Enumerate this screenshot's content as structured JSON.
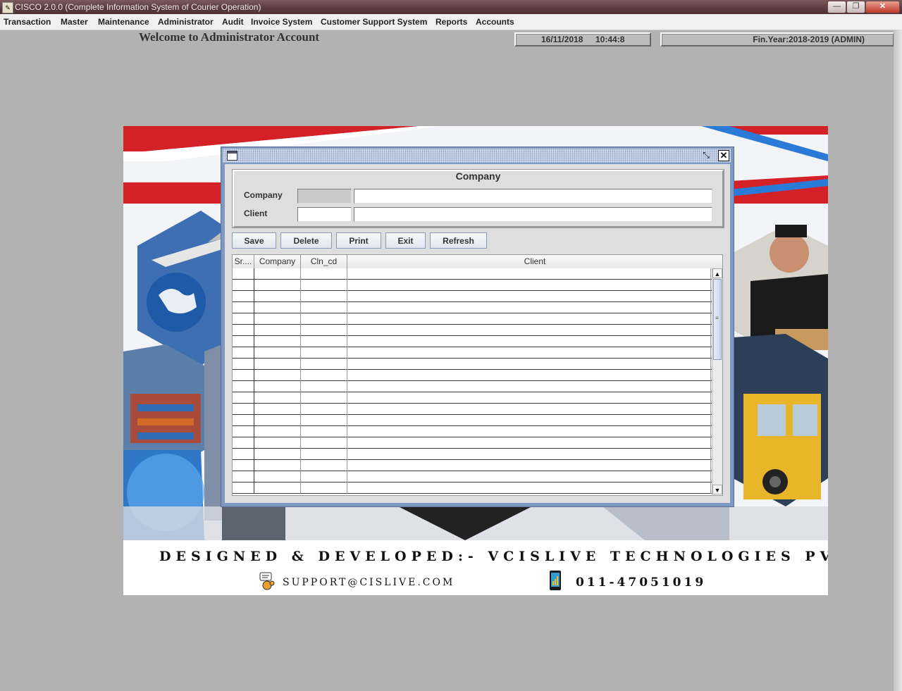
{
  "window": {
    "title": "CISCO 2.0.0 (Complete Information System of Courier Operation)",
    "app_icon": "app-icon",
    "controls": {
      "minimize": "—",
      "maximize": "❐",
      "close": "✕"
    }
  },
  "menu": {
    "items": [
      {
        "label": "Transaction"
      },
      {
        "label": "Master"
      },
      {
        "label": "Maintenance"
      },
      {
        "label": "Administrator"
      },
      {
        "label": "Audit"
      },
      {
        "label": "Invoice System"
      },
      {
        "label": "Customer Support System"
      },
      {
        "label": "Reports"
      },
      {
        "label": "Accounts"
      }
    ]
  },
  "header": {
    "welcome": "Welcome to Administrator Account",
    "date": "16/11/2018",
    "time": "10:44:8",
    "fin_year": "Fin.Year:2018-2019  (ADMIN)"
  },
  "banner": {
    "footer_title": "DESIGNED & DEVELOPED:- VCISLIVE TECHNOLOGIES PVT LTD",
    "email": "SUPPORT@CISLIVE.COM",
    "phone": "011-47051019"
  },
  "dialog": {
    "group_title": "Company",
    "fields": {
      "company_label": "Company",
      "company_code": "",
      "company_name": "",
      "client_label": "Client",
      "client_code": "",
      "client_name": ""
    },
    "buttons": {
      "save": "Save",
      "delete": "Delete",
      "print": "Print",
      "exit": "Exit",
      "refresh": "Refresh"
    },
    "table": {
      "columns": [
        "Sr....",
        "Company",
        "Cln_cd",
        "Client"
      ],
      "rows": []
    }
  },
  "colors": {
    "desktop": "#b2b2b2",
    "frame_border": "#7e98c4",
    "banner_red": "#d42027",
    "banner_blue": "#2a7bd8"
  }
}
